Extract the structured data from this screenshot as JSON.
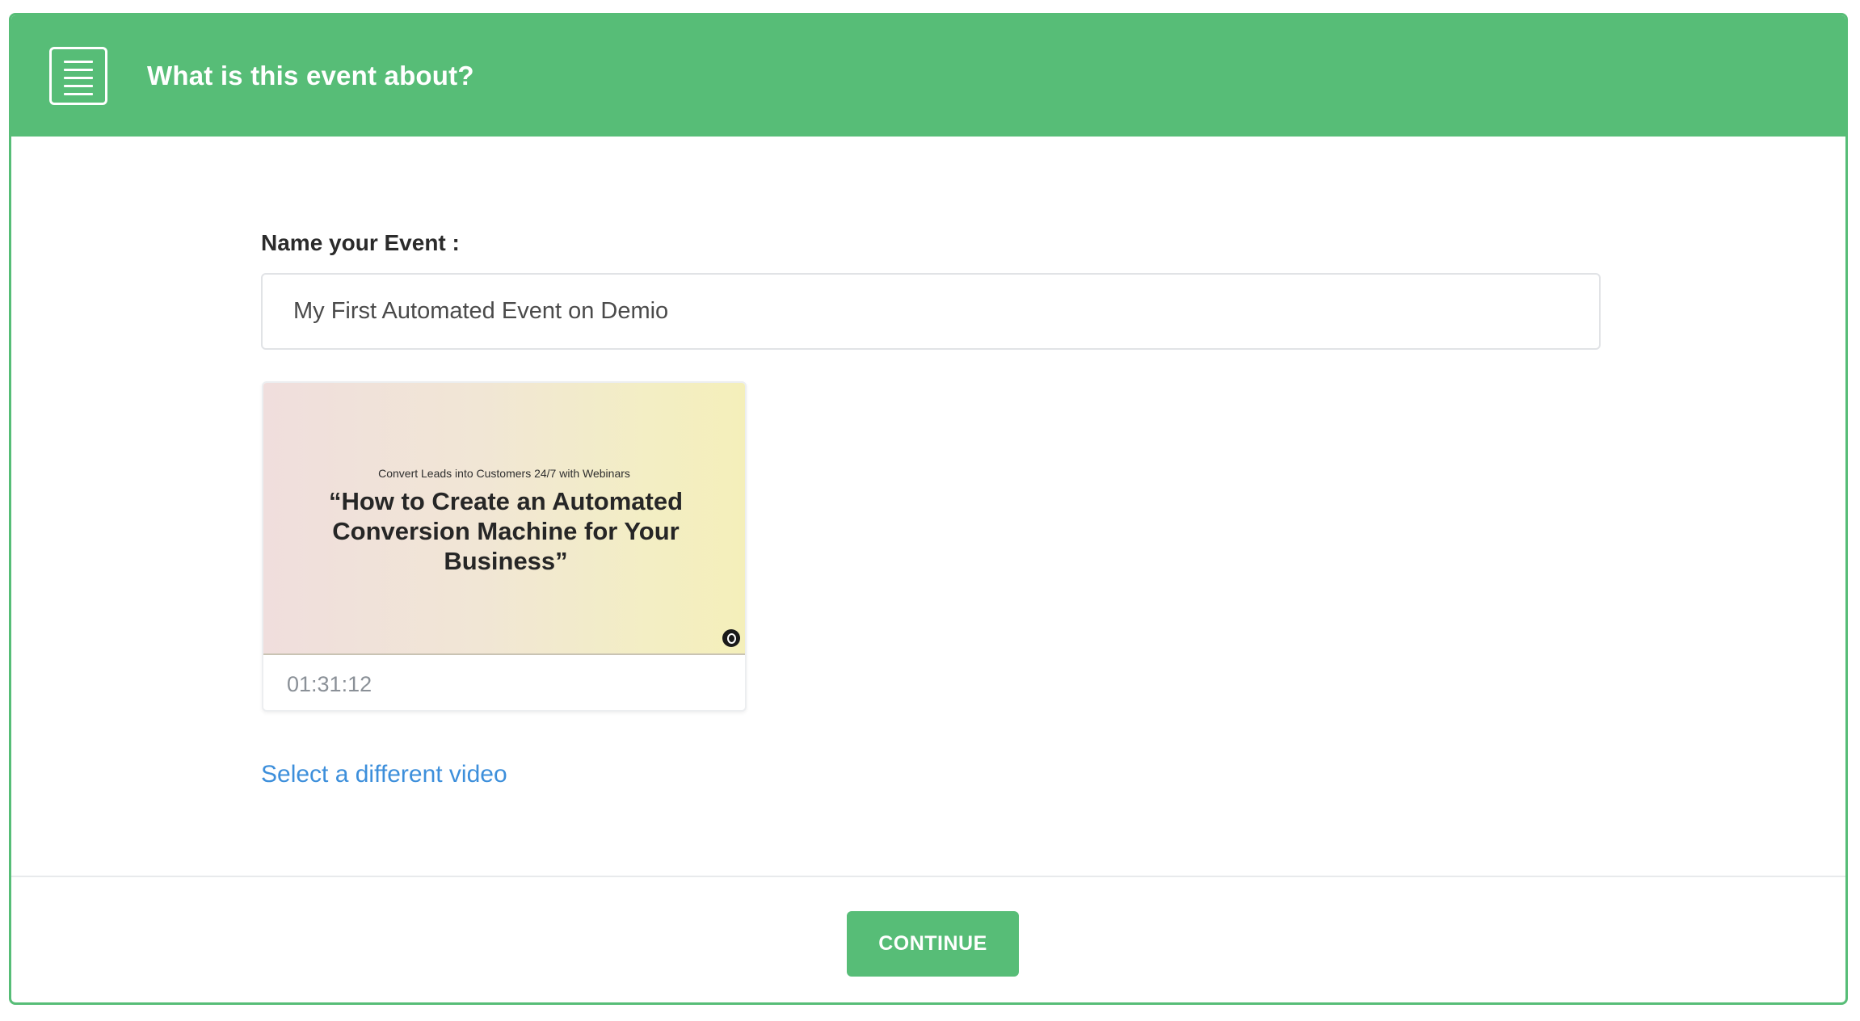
{
  "header": {
    "title": "What is this event about?",
    "menu_icon": "menu-icon"
  },
  "form": {
    "name_label": "Name your Event :",
    "name_value": "My First Automated Event on Demio"
  },
  "video": {
    "thumbnail_subtitle": "Convert Leads into Customers 24/7 with Webinars",
    "thumbnail_title": "“How to Create an Automated Conversion Machine for Your Business”",
    "duration": "01:31:12",
    "logo_icon": "demio-logo-icon"
  },
  "links": {
    "select_different_video": "Select a different video"
  },
  "footer": {
    "continue_label": "CONTINUE"
  },
  "colors": {
    "accent": "#57bd77",
    "link": "#3d8fdb"
  }
}
